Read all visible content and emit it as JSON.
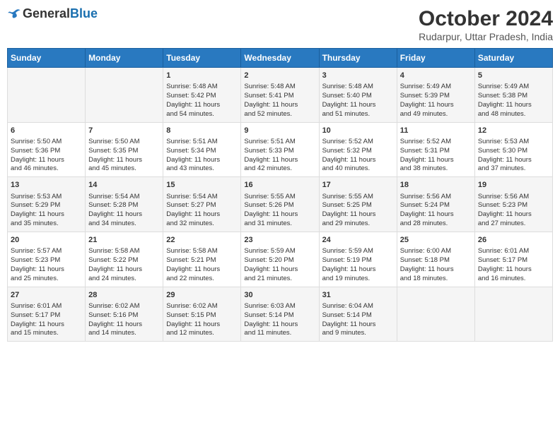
{
  "header": {
    "logo_line1": "General",
    "logo_line2": "Blue",
    "title": "October 2024",
    "subtitle": "Rudarpur, Uttar Pradesh, India"
  },
  "days_of_week": [
    "Sunday",
    "Monday",
    "Tuesday",
    "Wednesday",
    "Thursday",
    "Friday",
    "Saturday"
  ],
  "weeks": [
    [
      {
        "num": "",
        "info": ""
      },
      {
        "num": "",
        "info": ""
      },
      {
        "num": "1",
        "info": "Sunrise: 5:48 AM\nSunset: 5:42 PM\nDaylight: 11 hours\nand 54 minutes."
      },
      {
        "num": "2",
        "info": "Sunrise: 5:48 AM\nSunset: 5:41 PM\nDaylight: 11 hours\nand 52 minutes."
      },
      {
        "num": "3",
        "info": "Sunrise: 5:48 AM\nSunset: 5:40 PM\nDaylight: 11 hours\nand 51 minutes."
      },
      {
        "num": "4",
        "info": "Sunrise: 5:49 AM\nSunset: 5:39 PM\nDaylight: 11 hours\nand 49 minutes."
      },
      {
        "num": "5",
        "info": "Sunrise: 5:49 AM\nSunset: 5:38 PM\nDaylight: 11 hours\nand 48 minutes."
      }
    ],
    [
      {
        "num": "6",
        "info": "Sunrise: 5:50 AM\nSunset: 5:36 PM\nDaylight: 11 hours\nand 46 minutes."
      },
      {
        "num": "7",
        "info": "Sunrise: 5:50 AM\nSunset: 5:35 PM\nDaylight: 11 hours\nand 45 minutes."
      },
      {
        "num": "8",
        "info": "Sunrise: 5:51 AM\nSunset: 5:34 PM\nDaylight: 11 hours\nand 43 minutes."
      },
      {
        "num": "9",
        "info": "Sunrise: 5:51 AM\nSunset: 5:33 PM\nDaylight: 11 hours\nand 42 minutes."
      },
      {
        "num": "10",
        "info": "Sunrise: 5:52 AM\nSunset: 5:32 PM\nDaylight: 11 hours\nand 40 minutes."
      },
      {
        "num": "11",
        "info": "Sunrise: 5:52 AM\nSunset: 5:31 PM\nDaylight: 11 hours\nand 38 minutes."
      },
      {
        "num": "12",
        "info": "Sunrise: 5:53 AM\nSunset: 5:30 PM\nDaylight: 11 hours\nand 37 minutes."
      }
    ],
    [
      {
        "num": "13",
        "info": "Sunrise: 5:53 AM\nSunset: 5:29 PM\nDaylight: 11 hours\nand 35 minutes."
      },
      {
        "num": "14",
        "info": "Sunrise: 5:54 AM\nSunset: 5:28 PM\nDaylight: 11 hours\nand 34 minutes."
      },
      {
        "num": "15",
        "info": "Sunrise: 5:54 AM\nSunset: 5:27 PM\nDaylight: 11 hours\nand 32 minutes."
      },
      {
        "num": "16",
        "info": "Sunrise: 5:55 AM\nSunset: 5:26 PM\nDaylight: 11 hours\nand 31 minutes."
      },
      {
        "num": "17",
        "info": "Sunrise: 5:55 AM\nSunset: 5:25 PM\nDaylight: 11 hours\nand 29 minutes."
      },
      {
        "num": "18",
        "info": "Sunrise: 5:56 AM\nSunset: 5:24 PM\nDaylight: 11 hours\nand 28 minutes."
      },
      {
        "num": "19",
        "info": "Sunrise: 5:56 AM\nSunset: 5:23 PM\nDaylight: 11 hours\nand 27 minutes."
      }
    ],
    [
      {
        "num": "20",
        "info": "Sunrise: 5:57 AM\nSunset: 5:23 PM\nDaylight: 11 hours\nand 25 minutes."
      },
      {
        "num": "21",
        "info": "Sunrise: 5:58 AM\nSunset: 5:22 PM\nDaylight: 11 hours\nand 24 minutes."
      },
      {
        "num": "22",
        "info": "Sunrise: 5:58 AM\nSunset: 5:21 PM\nDaylight: 11 hours\nand 22 minutes."
      },
      {
        "num": "23",
        "info": "Sunrise: 5:59 AM\nSunset: 5:20 PM\nDaylight: 11 hours\nand 21 minutes."
      },
      {
        "num": "24",
        "info": "Sunrise: 5:59 AM\nSunset: 5:19 PM\nDaylight: 11 hours\nand 19 minutes."
      },
      {
        "num": "25",
        "info": "Sunrise: 6:00 AM\nSunset: 5:18 PM\nDaylight: 11 hours\nand 18 minutes."
      },
      {
        "num": "26",
        "info": "Sunrise: 6:01 AM\nSunset: 5:17 PM\nDaylight: 11 hours\nand 16 minutes."
      }
    ],
    [
      {
        "num": "27",
        "info": "Sunrise: 6:01 AM\nSunset: 5:17 PM\nDaylight: 11 hours\nand 15 minutes."
      },
      {
        "num": "28",
        "info": "Sunrise: 6:02 AM\nSunset: 5:16 PM\nDaylight: 11 hours\nand 14 minutes."
      },
      {
        "num": "29",
        "info": "Sunrise: 6:02 AM\nSunset: 5:15 PM\nDaylight: 11 hours\nand 12 minutes."
      },
      {
        "num": "30",
        "info": "Sunrise: 6:03 AM\nSunset: 5:14 PM\nDaylight: 11 hours\nand 11 minutes."
      },
      {
        "num": "31",
        "info": "Sunrise: 6:04 AM\nSunset: 5:14 PM\nDaylight: 11 hours\nand 9 minutes."
      },
      {
        "num": "",
        "info": ""
      },
      {
        "num": "",
        "info": ""
      }
    ]
  ]
}
